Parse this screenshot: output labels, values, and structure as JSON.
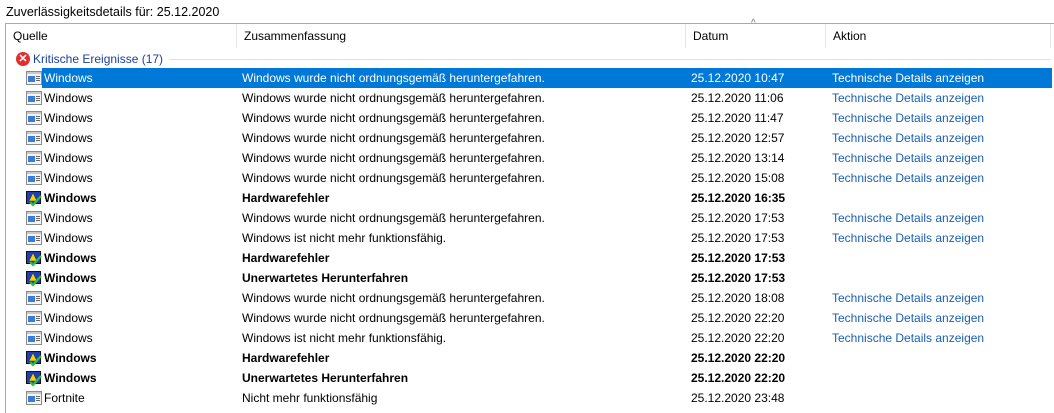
{
  "title": "Zuverlässigkeitsdetails für: 25.12.2020",
  "columns": [
    "Quelle",
    "Zusammenfassung",
    "Datum",
    "Aktion"
  ],
  "group": {
    "label": "Kritische Ereignisse (17)",
    "icon": "error-icon"
  },
  "rows": [
    {
      "source": "Windows",
      "summary": "Windows wurde nicht ordnungsgemäß heruntergefahren.",
      "date": "25.12.2020 10:47",
      "action": "Technische Details anzeigen",
      "icon": "window-icon",
      "bold": false,
      "selected": true
    },
    {
      "source": "Windows",
      "summary": "Windows wurde nicht ordnungsgemäß heruntergefahren.",
      "date": "25.12.2020 11:06",
      "action": "Technische Details anzeigen",
      "icon": "window-icon",
      "bold": false
    },
    {
      "source": "Windows",
      "summary": "Windows wurde nicht ordnungsgemäß heruntergefahren.",
      "date": "25.12.2020 11:47",
      "action": "Technische Details anzeigen",
      "icon": "window-icon",
      "bold": false
    },
    {
      "source": "Windows",
      "summary": "Windows wurde nicht ordnungsgemäß heruntergefahren.",
      "date": "25.12.2020 12:57",
      "action": "Technische Details anzeigen",
      "icon": "window-icon",
      "bold": false
    },
    {
      "source": "Windows",
      "summary": "Windows wurde nicht ordnungsgemäß heruntergefahren.",
      "date": "25.12.2020 13:14",
      "action": "Technische Details anzeigen",
      "icon": "window-icon",
      "bold": false
    },
    {
      "source": "Windows",
      "summary": "Windows wurde nicht ordnungsgemäß heruntergefahren.",
      "date": "25.12.2020 15:08",
      "action": "Technische Details anzeigen",
      "icon": "window-icon",
      "bold": false
    },
    {
      "source": "Windows",
      "summary": "Hardwarefehler",
      "date": "25.12.2020 16:35",
      "action": "",
      "icon": "hardware-check-icon",
      "bold": true
    },
    {
      "source": "Windows",
      "summary": "Windows wurde nicht ordnungsgemäß heruntergefahren.",
      "date": "25.12.2020 17:53",
      "action": "Technische Details anzeigen",
      "icon": "window-icon",
      "bold": false
    },
    {
      "source": "Windows",
      "summary": "Windows ist nicht mehr funktionsfähig.",
      "date": "25.12.2020 17:53",
      "action": "Technische Details anzeigen",
      "icon": "window-icon",
      "bold": false
    },
    {
      "source": "Windows",
      "summary": "Hardwarefehler",
      "date": "25.12.2020 17:53",
      "action": "",
      "icon": "hardware-check-icon",
      "bold": true
    },
    {
      "source": "Windows",
      "summary": "Unerwartetes Herunterfahren",
      "date": "25.12.2020 17:53",
      "action": "",
      "icon": "hardware-check-icon",
      "bold": true
    },
    {
      "source": "Windows",
      "summary": "Windows wurde nicht ordnungsgemäß heruntergefahren.",
      "date": "25.12.2020 18:08",
      "action": "Technische Details anzeigen",
      "icon": "window-icon",
      "bold": false
    },
    {
      "source": "Windows",
      "summary": "Windows wurde nicht ordnungsgemäß heruntergefahren.",
      "date": "25.12.2020 22:20",
      "action": "Technische Details anzeigen",
      "icon": "window-icon",
      "bold": false
    },
    {
      "source": "Windows",
      "summary": "Windows ist nicht mehr funktionsfähig.",
      "date": "25.12.2020 22:20",
      "action": "Technische Details anzeigen",
      "icon": "window-icon",
      "bold": false
    },
    {
      "source": "Windows",
      "summary": "Hardwarefehler",
      "date": "25.12.2020 22:20",
      "action": "",
      "icon": "hardware-check-icon",
      "bold": true
    },
    {
      "source": "Windows",
      "summary": "Unerwartetes Herunterfahren",
      "date": "25.12.2020 22:20",
      "action": "",
      "icon": "hardware-check-icon",
      "bold": true
    },
    {
      "source": "Fortnite",
      "summary": "Nicht mehr funktionsfähig",
      "date": "25.12.2020 23:48",
      "action": "",
      "icon": "window-icon",
      "bold": false
    }
  ]
}
